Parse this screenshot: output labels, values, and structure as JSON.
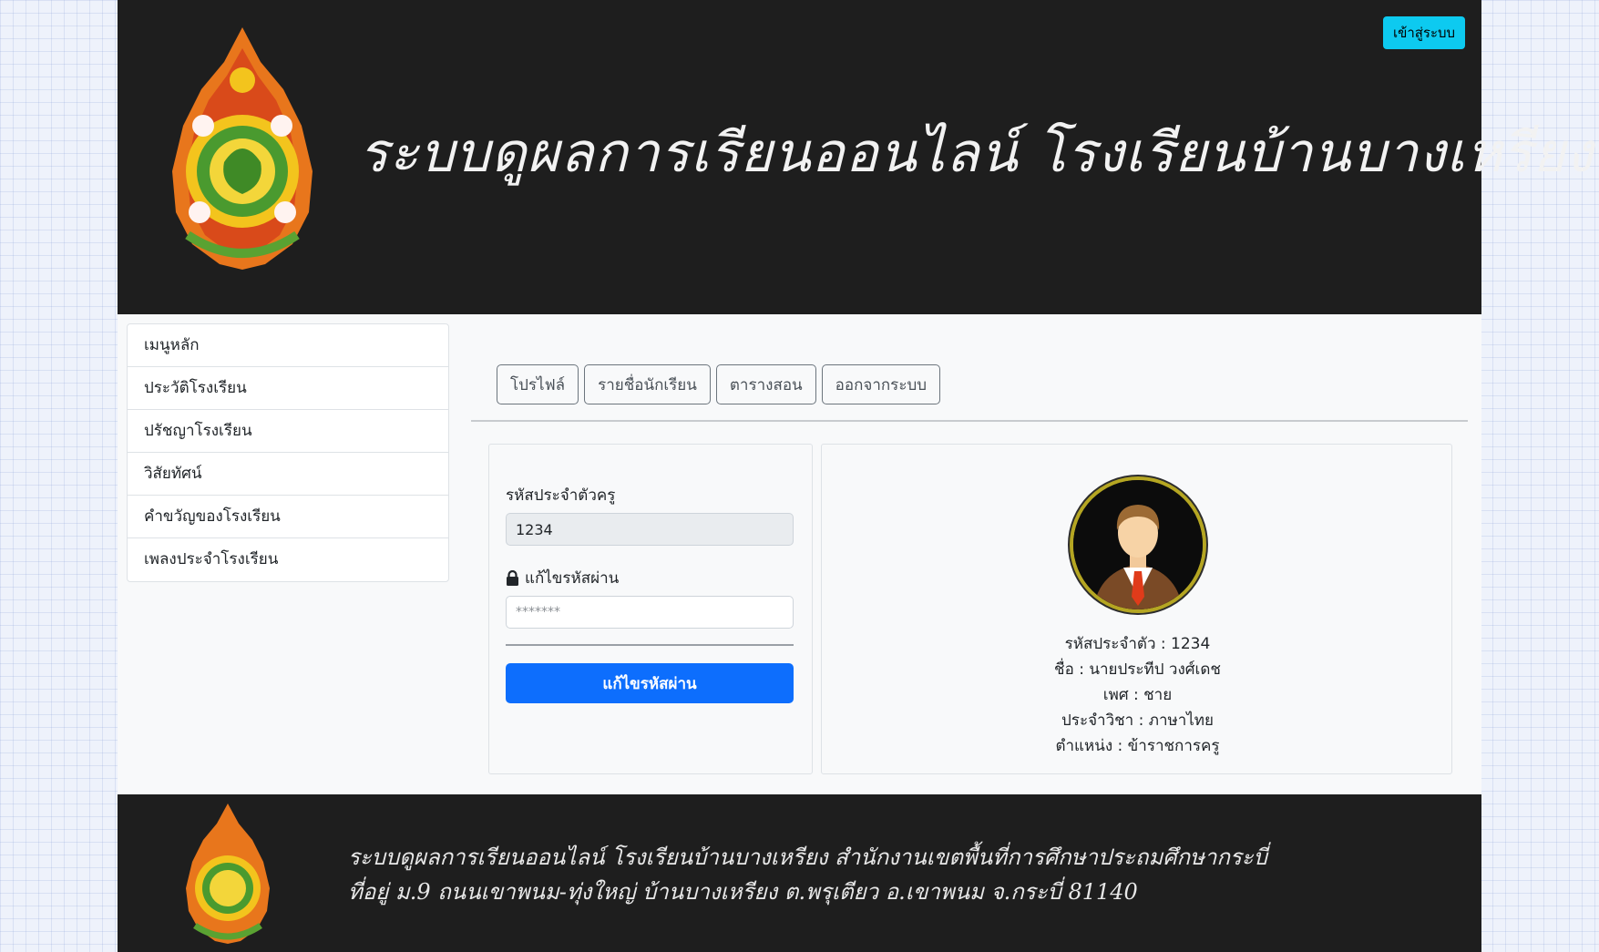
{
  "header": {
    "login_label": "เข้าสู่ระบบ",
    "title": "ระบบดูผลการเรียนออนไลน์ โรงเรียนบ้านบางเหรียง"
  },
  "sidebar": {
    "items": [
      {
        "label": "เมนูหลัก"
      },
      {
        "label": "ประวัติโรงเรียน"
      },
      {
        "label": "ปรัชญาโรงเรียน"
      },
      {
        "label": "วิสัยทัศน์"
      },
      {
        "label": "คำขวัญของโรงเรียน"
      },
      {
        "label": "เพลงประจำโรงเรียน"
      }
    ]
  },
  "tabs": [
    {
      "label": "โปรไฟล์"
    },
    {
      "label": "รายชื่อนักเรียน"
    },
    {
      "label": "ตารางสอน"
    },
    {
      "label": "ออกจากระบบ"
    }
  ],
  "password_form": {
    "id_label": "รหัสประจำตัวครู",
    "id_value": "1234",
    "password_label": "แก้ไขรหัสผ่าน",
    "password_placeholder": "*******",
    "submit_label": "แก้ไขรหัสผ่าน",
    "lock_icon": "lock-icon"
  },
  "profile": {
    "avatar_icon": "teacher-avatar",
    "id_line": "รหัสประจำตัว : 1234",
    "name_line": "ชื่อ : นายประทีป วงศ์เดช",
    "gender_line": "เพศ : ชาย",
    "subject_line": "ประจำวิชา : ภาษาไทย",
    "position_line": "ตำแหน่ง : ข้าราชการครู"
  },
  "footer": {
    "line1": "ระบบดูผลการเรียนออนไลน์ โรงเรียนบ้านบางเหรียง  สำนักงานเขตพื้นที่การศึกษาประถมศึกษากระบี่",
    "line2": "ที่อยู่ ม.9 ถนนเขาพนม-ทุ่งใหญ่  บ้านบางเหรียง  ต.พรุเตียว  อ.เขาพนม จ.กระบี่  81140"
  },
  "colors": {
    "header_bg": "#1e1e1e",
    "login_button": "#0dcaf0",
    "primary_button": "#0d6efd",
    "avatar_ring": "#b5a622"
  }
}
